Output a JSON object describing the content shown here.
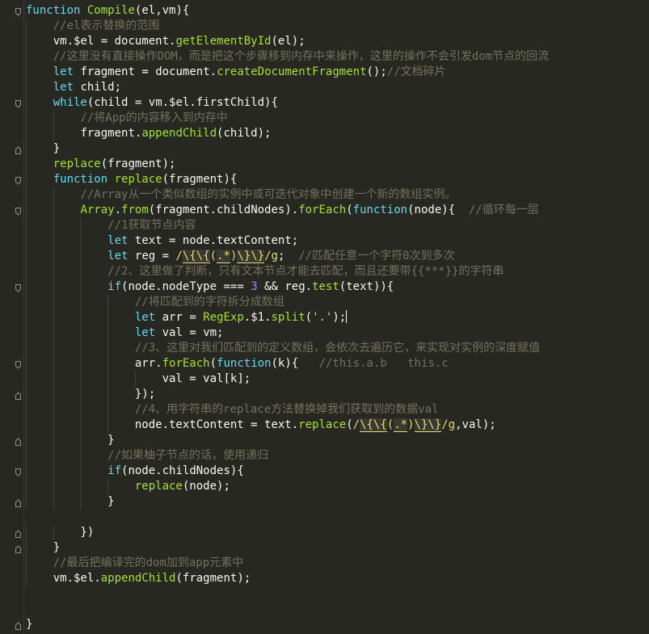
{
  "editor": {
    "language": "javascript",
    "theme_colors": {
      "background": "#272822",
      "keyword": "#66d9ef",
      "function": "#a6e22e",
      "comment": "#75715e",
      "string": "#e6db74",
      "number": "#ae81ff",
      "param": "#fd971f",
      "text": "#f8f8f2"
    },
    "fold_icons": [
      "fold-down-icon"
    ],
    "lines": [
      "function Compile(el,vm){",
      "    //el表示替换的范围",
      "    vm.$el = document.getElementById(el);",
      "    //这里没有直接操作DOM，而是把这个步骤移到内存中来操作，这里的操作不会引发dom节点的回流",
      "    let fragment = document.createDocumentFragment();//文档碎片",
      "    let child;",
      "    while(child = vm.$el.firstChild){",
      "        //将App的内容移入到内存中",
      "        fragment.appendChild(child);",
      "    }",
      "    replace(fragment);",
      "    function replace(fragment){",
      "        //Array从一个类似数组的实例中或可迭代对象中创建一个新的数组实例。",
      "        Array.from(fragment.childNodes).forEach(function(node){  //循环每一层",
      "            //1获取节点内容",
      "            let text = node.textContent;",
      "            let reg = /\\{\\{(.*)\\}\\}/g;  //匹配任意一个字符0次到多次",
      "            //2、这里做了判断，只有文本节点才能去匹配，而且还要带{{***}}的字符串",
      "            if(node.nodeType === 3 && reg.test(text)){",
      "                //将匹配到的字符拆分成数组",
      "                let arr = RegExp.$1.split('.');",
      "                let val = vm;",
      "                //3、这里对我们匹配到的定义数组，会依次去遍历它，来实现对实例的深度赋值",
      "                arr.forEach(function(k){   //this.a.b   this.c",
      "                    val = val[k];",
      "                });",
      "                //4、用字符串的replace方法替换掉我们获取到的数据val",
      "                node.textContent = text.replace(/\\{\\{(.*)\\}\\}/g,val);",
      "            }",
      "            //如果柚子节点的话，使用递归",
      "            if(node.childNodes){",
      "                replace(node);",
      "            }",
      "",
      "        })",
      "    }",
      "    //最后把编译完的dom加到app元素中",
      "    vm.$el.appendChild(fragment);",
      "",
      "",
      "}"
    ]
  }
}
